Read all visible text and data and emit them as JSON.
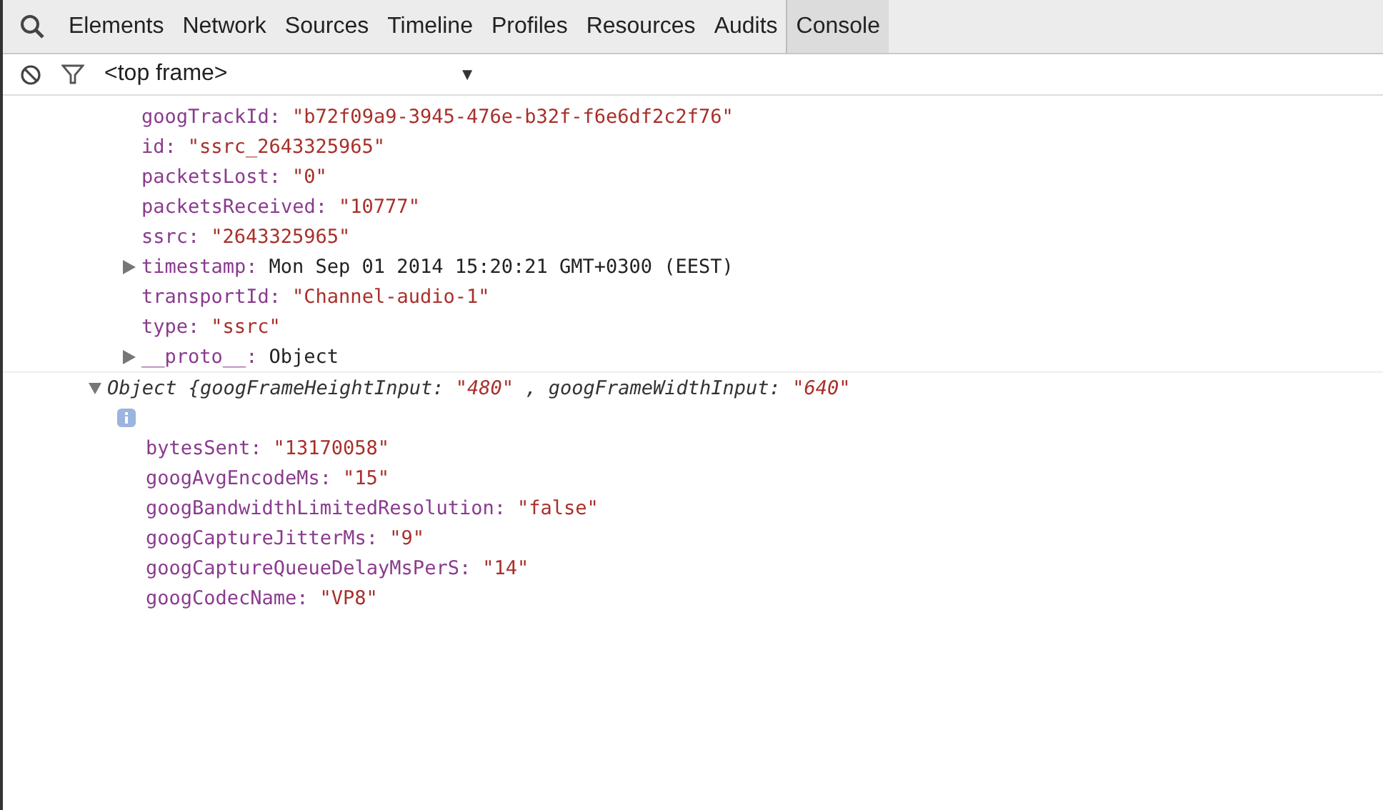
{
  "tabs": [
    {
      "label": "Elements",
      "selected": false
    },
    {
      "label": "Network",
      "selected": false
    },
    {
      "label": "Sources",
      "selected": false
    },
    {
      "label": "Timeline",
      "selected": false
    },
    {
      "label": "Profiles",
      "selected": false
    },
    {
      "label": "Resources",
      "selected": false
    },
    {
      "label": "Audits",
      "selected": false
    },
    {
      "label": "Console",
      "selected": true
    }
  ],
  "toolbar": {
    "frame_select": "<top frame>",
    "dropdown_arrow": "▼"
  },
  "console": {
    "properties": [
      {
        "key": "googTrackId:",
        "value": "\"b72f09a9-3945-476e-b32f-f6e6df2c2f76\"",
        "kind": "string"
      },
      {
        "key": "id:",
        "value": "\"ssrc_2643325965\"",
        "kind": "string"
      },
      {
        "key": "packetsLost:",
        "value": "\"0\"",
        "kind": "string"
      },
      {
        "key": "packetsReceived:",
        "value": "\"10777\"",
        "kind": "string"
      },
      {
        "key": "ssrc:",
        "value": "\"2643325965\"",
        "kind": "string"
      },
      {
        "key": "timestamp:",
        "value": "Mon Sep 01 2014 15:20:21 GMT+0300 (EEST)",
        "kind": "object",
        "expanded": false
      },
      {
        "key": "transportId:",
        "value": "\"Channel-audio-1\"",
        "kind": "string"
      },
      {
        "key": "type:",
        "value": "\"ssrc\"",
        "kind": "string"
      },
      {
        "key": "__proto__:",
        "value": "Object",
        "kind": "object",
        "expanded": false
      }
    ],
    "objects": [
      {
        "expanded": true,
        "summary": [
          {
            "text": "Object {googFrameHeightInput:",
            "kind": "key"
          },
          {
            "text": "\"480\"",
            "kind": "string"
          },
          {
            "text": ", googFrameWidthInput:",
            "kind": "key"
          },
          {
            "text": "\"640\"",
            "kind": "string"
          }
        ],
        "properties": [
          {
            "key": "bytesSent:",
            "value": "\"13170058\"",
            "kind": "string"
          },
          {
            "key": "googAvgEncodeMs:",
            "value": "\"15\"",
            "kind": "string"
          },
          {
            "key": "googBandwidthLimitedResolution:",
            "value": "\"false\"",
            "kind": "string"
          },
          {
            "key": "googCaptureJitterMs:",
            "value": "\"9\"",
            "kind": "string"
          },
          {
            "key": "googCaptureQueueDelayMsPerS:",
            "value": "\"14\"",
            "kind": "string"
          },
          {
            "key": "googCodecName:",
            "value": "\"VP8\"",
            "kind": "string"
          }
        ]
      }
    ]
  }
}
